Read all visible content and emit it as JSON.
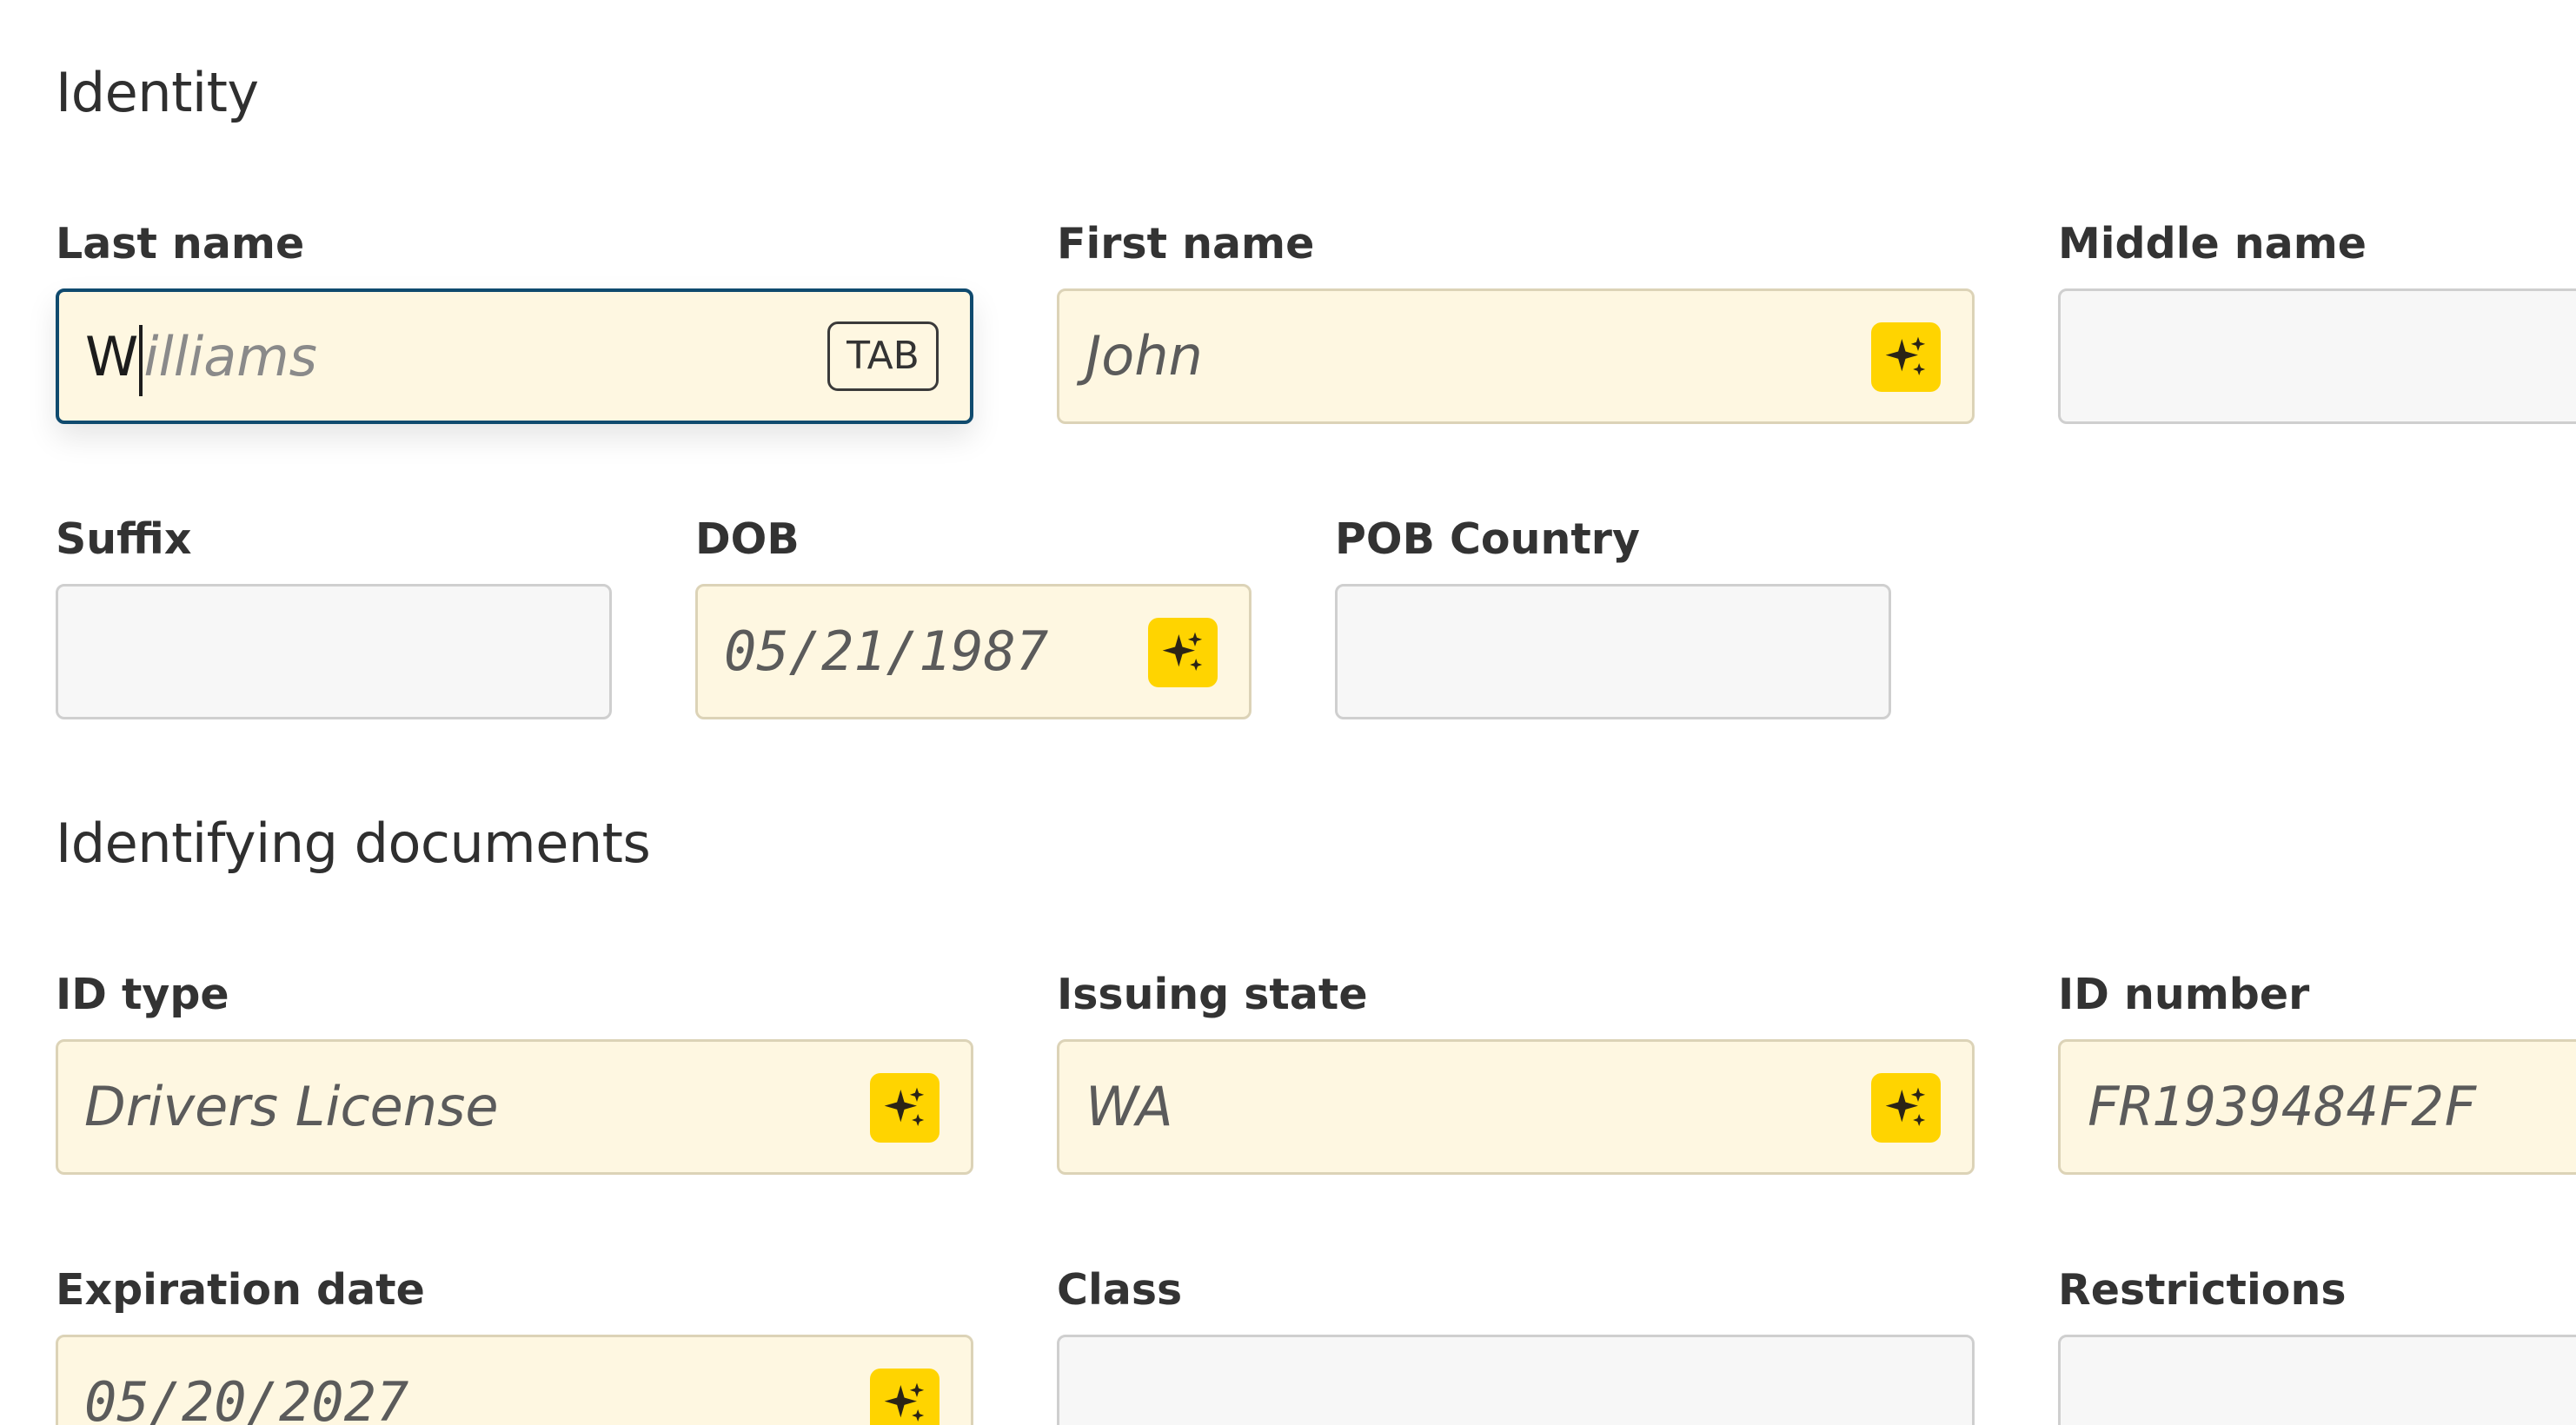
{
  "sections": {
    "identity": {
      "title": "Identity"
    },
    "documents": {
      "title": "Identifying documents"
    }
  },
  "fields": {
    "last_name": {
      "label": "Last name",
      "typed": "W",
      "suggestion": "illiams",
      "hint_key": "TAB",
      "state": "focused-autocomplete"
    },
    "first_name": {
      "label": "First name",
      "value": "John",
      "state": "ai-filled"
    },
    "middle_name": {
      "label": "Middle name",
      "value": "",
      "state": "empty"
    },
    "suffix": {
      "label": "Suffix",
      "value": "",
      "state": "empty"
    },
    "dob": {
      "label": "DOB",
      "value": "05/21/1987",
      "state": "ai-filled"
    },
    "pob_country": {
      "label": "POB Country",
      "value": "",
      "state": "empty"
    },
    "id_type": {
      "label": "ID type",
      "value": "Drivers License",
      "state": "ai-filled"
    },
    "issuing_state": {
      "label": "Issuing state",
      "value": "WA",
      "state": "ai-filled"
    },
    "id_number": {
      "label": "ID number",
      "value": "FR1939484F2F",
      "state": "ai-filled"
    },
    "expiration_date": {
      "label": "Expiration date",
      "value": "05/20/2027",
      "state": "ai-filled"
    },
    "class": {
      "label": "Class",
      "value": "",
      "state": "empty"
    },
    "restrictions": {
      "label": "Restrictions",
      "value": "",
      "state": "empty"
    }
  },
  "icons": {
    "ai_badge": "sparkles-icon"
  },
  "colors": {
    "ai_field_bg": "#fef7e1",
    "ai_badge_bg": "#ffd400",
    "focus_border": "#0f4a6e",
    "empty_field_bg": "#f7f7f7"
  }
}
